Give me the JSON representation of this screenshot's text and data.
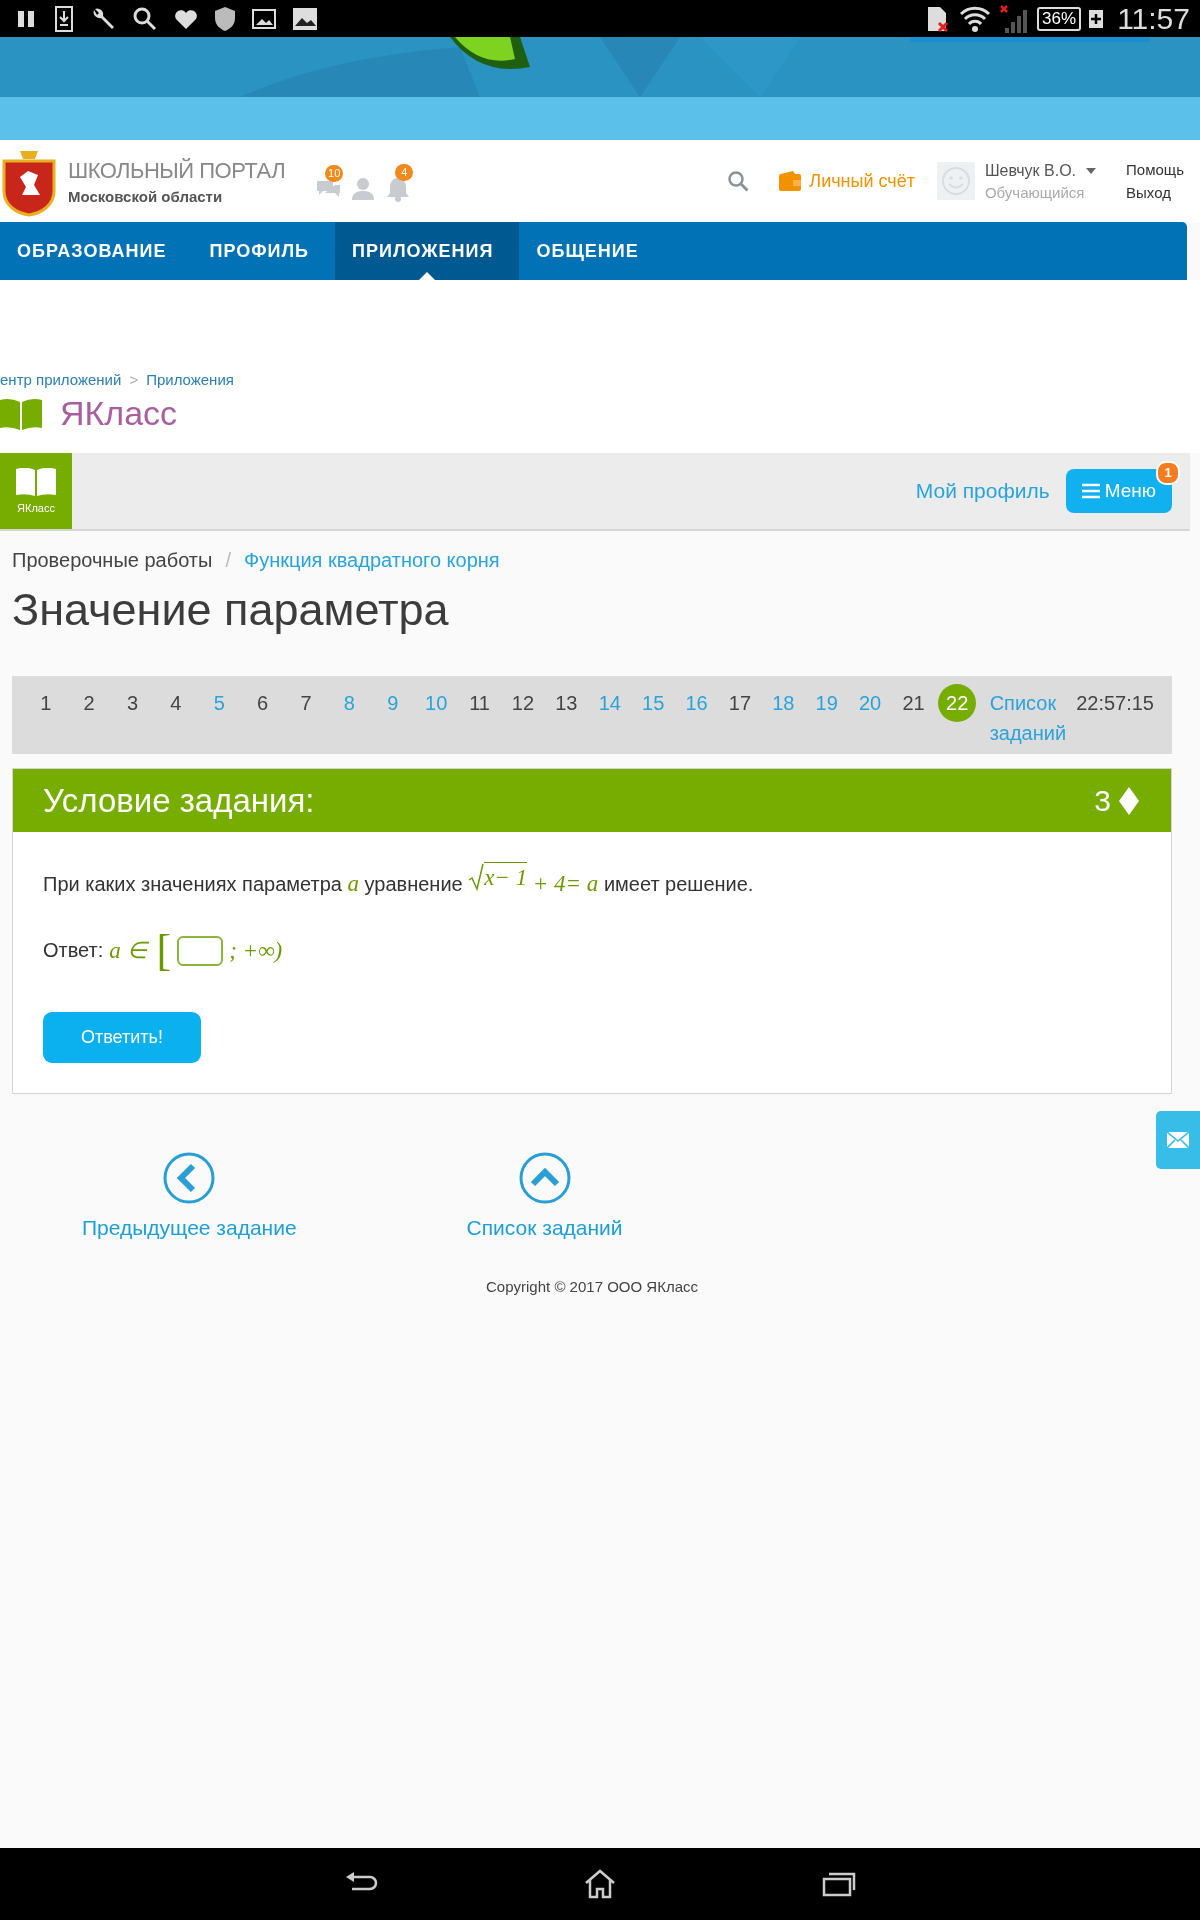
{
  "status_bar": {
    "battery": "36%",
    "time": "11:57"
  },
  "header": {
    "portal_title": "ШКОЛЬНЫЙ ПОРТАЛ",
    "portal_subtitle": "Московской области",
    "messages_badge": "10",
    "notifications_badge": "4",
    "account_link": "Личный счёт",
    "user_name": "Шевчук В.О.",
    "user_role": "Обучающийся",
    "help_link": "Помощь",
    "logout_link": "Выход"
  },
  "nav_tabs": [
    {
      "label": "ОБРАЗОВАНИЕ",
      "selected": false
    },
    {
      "label": "ПРОФИЛЬ",
      "selected": false
    },
    {
      "label": "ПРИЛОЖЕНИЯ",
      "selected": true
    },
    {
      "label": "ОБЩЕНИЕ",
      "selected": false
    }
  ],
  "app_breadcrumbs": [
    "ентр приложений",
    "Приложения"
  ],
  "app_breadcrumb_separator": ">",
  "app_title": "ЯКласс",
  "app_bar": {
    "logo_label": "ЯКласс",
    "profile_link": "Мой профиль",
    "menu_button": "Меню",
    "menu_badge": "1"
  },
  "breadcrumbs": [
    {
      "label": "Проверочные работы",
      "kind": "text"
    },
    {
      "label": "Функция квадратного корня",
      "kind": "link"
    }
  ],
  "breadcrumb_separator": "/",
  "page_title": "Значение параметра",
  "pagination": {
    "items": [
      {
        "label": "1",
        "kind": "plain",
        "selected": false
      },
      {
        "label": "2",
        "kind": "plain",
        "selected": false
      },
      {
        "label": "3",
        "kind": "plain",
        "selected": false
      },
      {
        "label": "4",
        "kind": "plain",
        "selected": false
      },
      {
        "label": "5",
        "kind": "link",
        "selected": false
      },
      {
        "label": "6",
        "kind": "plain",
        "selected": false
      },
      {
        "label": "7",
        "kind": "plain",
        "selected": false
      },
      {
        "label": "8",
        "kind": "link",
        "selected": false
      },
      {
        "label": "9",
        "kind": "link",
        "selected": false
      },
      {
        "label": "10",
        "kind": "link",
        "selected": false
      },
      {
        "label": "11",
        "kind": "plain",
        "selected": false
      },
      {
        "label": "12",
        "kind": "plain",
        "selected": false
      },
      {
        "label": "13",
        "kind": "plain",
        "selected": false
      },
      {
        "label": "14",
        "kind": "link",
        "selected": false
      },
      {
        "label": "15",
        "kind": "link",
        "selected": false
      },
      {
        "label": "16",
        "kind": "link",
        "selected": false
      },
      {
        "label": "17",
        "kind": "plain",
        "selected": false
      },
      {
        "label": "18",
        "kind": "link",
        "selected": false
      },
      {
        "label": "19",
        "kind": "link",
        "selected": false
      },
      {
        "label": "20",
        "kind": "link",
        "selected": false
      },
      {
        "label": "21",
        "kind": "plain",
        "selected": false
      },
      {
        "label": "22",
        "kind": "plain",
        "selected": true
      }
    ],
    "list_link": "Список заданий",
    "timer": "22:57:15"
  },
  "task": {
    "title": "Условие задания:",
    "points": "3",
    "question": [
      {
        "kind": "text",
        "text": "При каких значениях параметра"
      },
      {
        "kind": "math",
        "text": "a"
      },
      {
        "kind": "text",
        "text": "уравнение"
      },
      {
        "kind": "sqrt",
        "text": "x− 1"
      },
      {
        "kind": "math",
        "text": "+ 4= a"
      },
      {
        "kind": "text",
        "text": "имеет решение."
      }
    ],
    "answer_label": "Ответ:",
    "answer_math": "a ∈",
    "bracket": "[",
    "answer_tail": "; +∞)",
    "submit_button": "Ответить!"
  },
  "bottom_nav": [
    {
      "label": "Предыдущее задание",
      "kind": "previous"
    },
    {
      "label": "Список заданий",
      "kind": "list"
    }
  ],
  "copyright": "Copyright © 2017 ООО ЯКласс"
}
